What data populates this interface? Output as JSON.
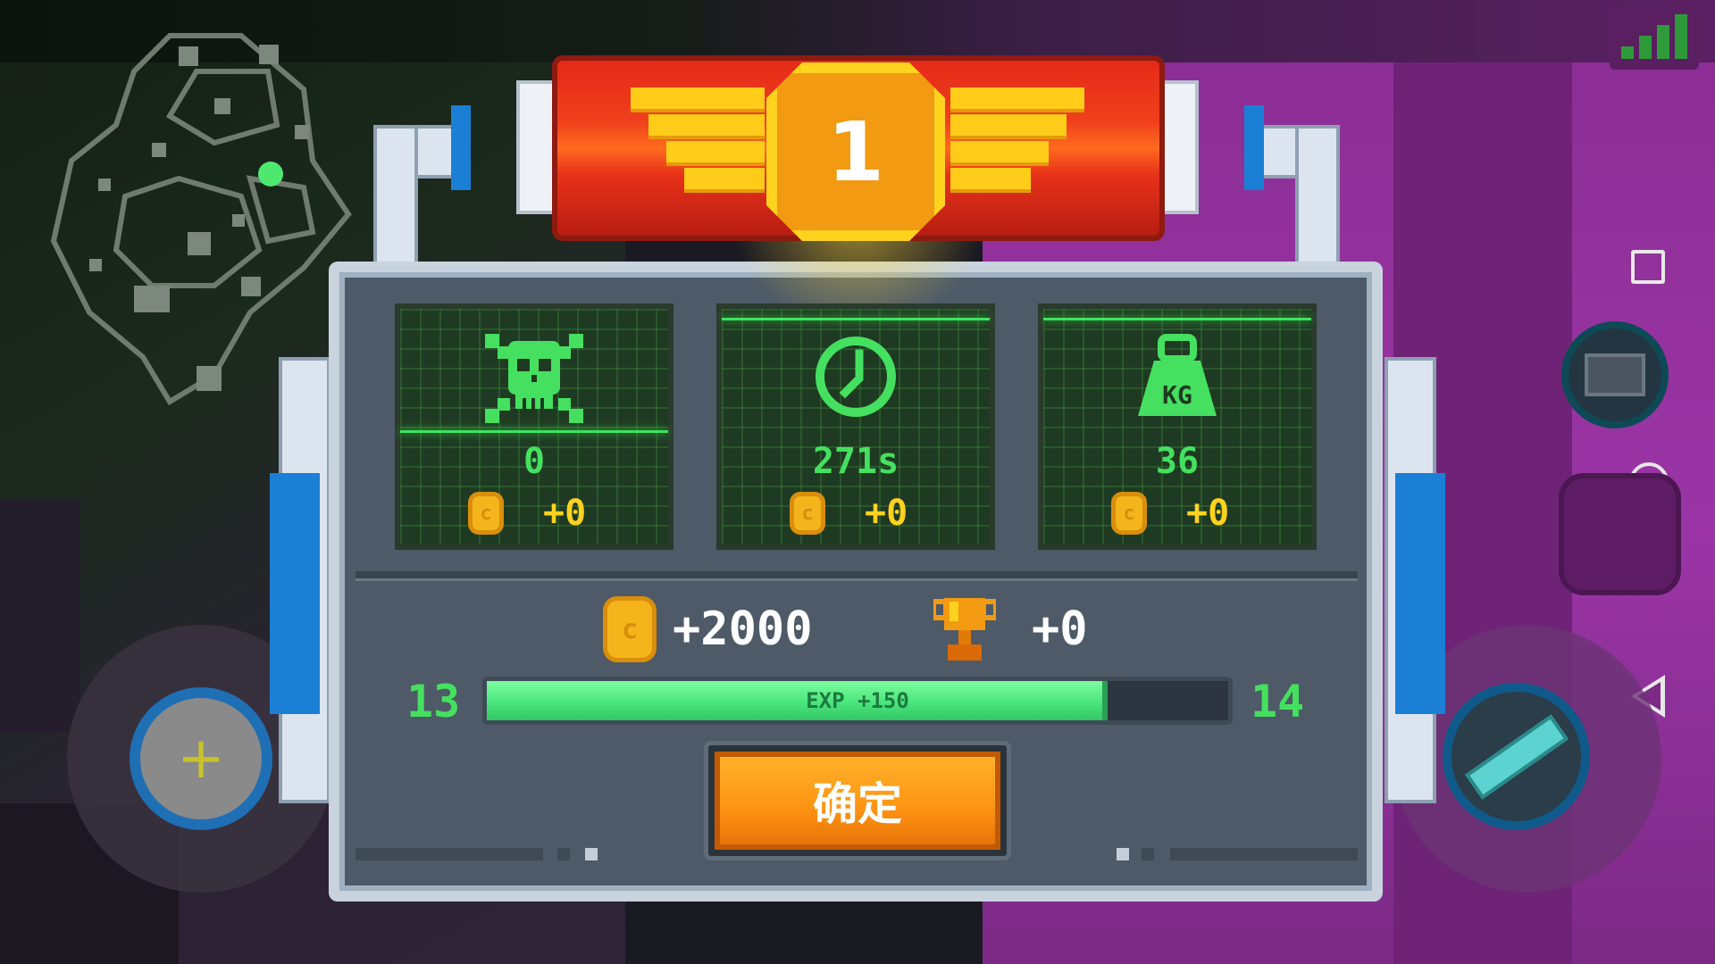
{
  "banner": {
    "rank": "1"
  },
  "stats": [
    {
      "icon": "skull-crossbones-icon",
      "value": "0",
      "bonus": "+0"
    },
    {
      "icon": "clock-icon",
      "value": "271s",
      "bonus": "+0"
    },
    {
      "icon": "weight-kg-icon",
      "weight_text": "KG",
      "value": "36",
      "bonus": "+0"
    }
  ],
  "rewards": {
    "coins": "+2000",
    "trophies": "+0"
  },
  "experience": {
    "current_level": "13",
    "next_level": "14",
    "label": "EXP +150",
    "progress": 0.83
  },
  "confirm_label": "确定",
  "colors": {
    "accent_green": "#45e060",
    "coin_gold": "#f4b51c",
    "confirm_orange": "#ff9615",
    "banner_red": "#e42a18"
  }
}
